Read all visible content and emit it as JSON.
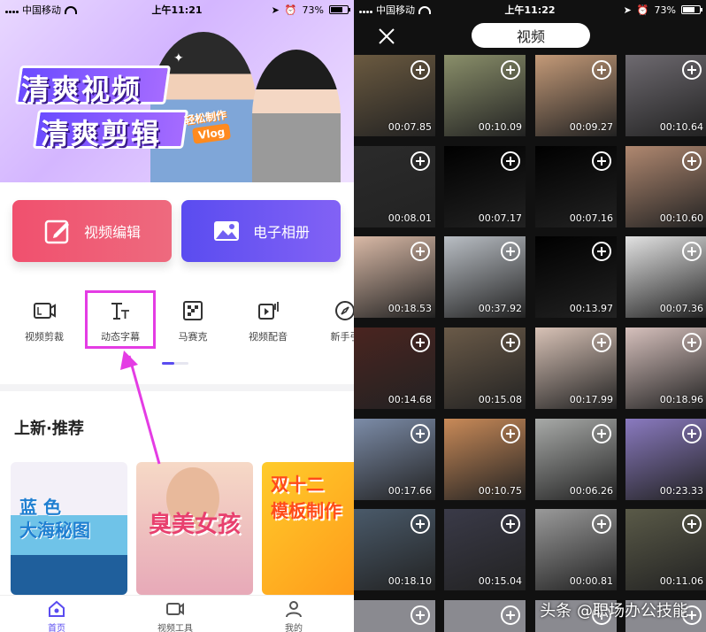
{
  "left": {
    "status": {
      "carrier": "中国移动",
      "time": "上午11:21",
      "battery": "73%"
    },
    "banner": {
      "line1": "清爽视频",
      "line2": "清爽剪辑",
      "sub": "轻松制作",
      "vlog": "Vlog"
    },
    "actions": {
      "video_edit": "视频编辑",
      "album": "电子相册"
    },
    "tools": [
      "视频剪裁",
      "动态字幕",
      "马赛克",
      "视频配音",
      "新手引"
    ],
    "section_title": "上新·推荐",
    "cards": [
      {
        "text": "蓝 色\n大海秘图"
      },
      {
        "text": "臭美女孩"
      },
      {
        "text": "双十二\n模板制作"
      }
    ],
    "nav": {
      "home": "首页",
      "tools": "视频工具",
      "me": "我的"
    }
  },
  "right": {
    "status": {
      "carrier": "中国移动",
      "time": "上午11:22",
      "battery": "73%"
    },
    "title": "视频",
    "durations": [
      "00:07.85",
      "00:10.09",
      "00:09.27",
      "00:10.64",
      "00:08.01",
      "00:07.17",
      "00:07.16",
      "00:10.60",
      "00:18.53",
      "00:37.92",
      "00:13.97",
      "00:07.36",
      "00:14.68",
      "00:15.08",
      "00:17.99",
      "00:18.96",
      "00:17.66",
      "00:10.75",
      "00:06.26",
      "00:23.33",
      "00:18.10",
      "00:15.04",
      "00:00.81",
      "00:11.06"
    ],
    "watermark": "头条 @职场办公技能"
  },
  "colors": {
    "accent": "#5a4cf0",
    "edit": "#f0506e",
    "highlight": "#e43ce4"
  }
}
